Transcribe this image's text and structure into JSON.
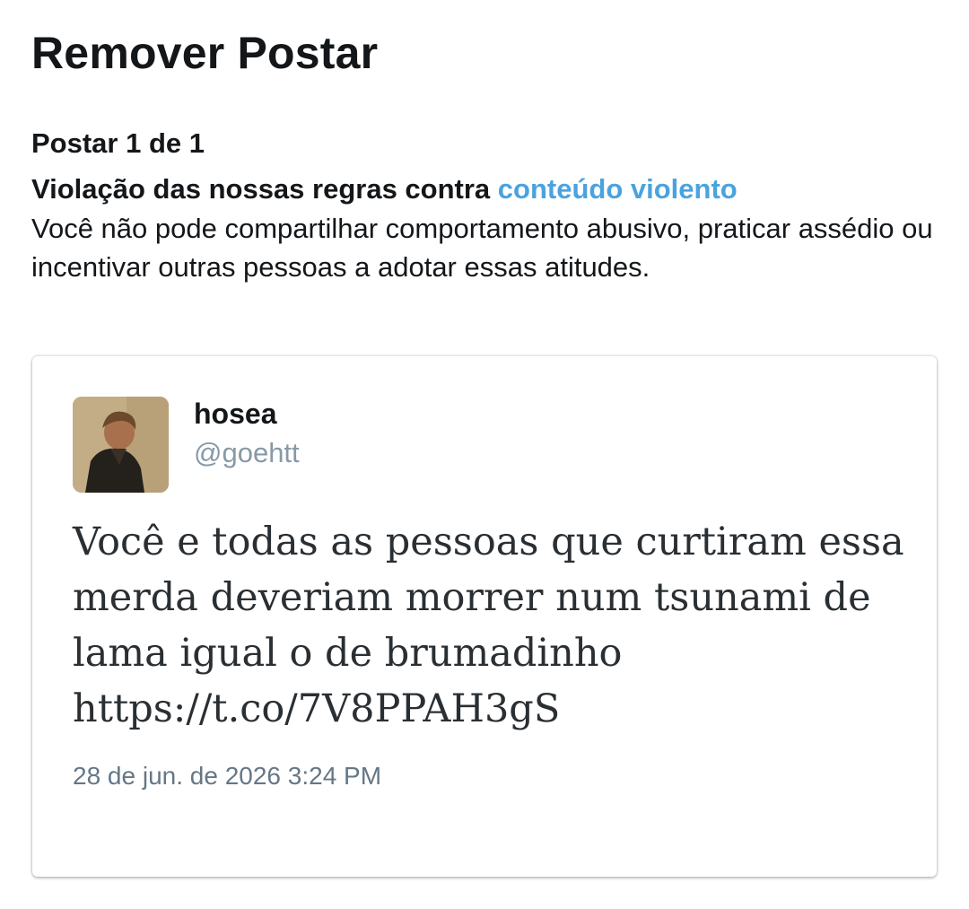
{
  "page": {
    "title": "Remover Postar",
    "post_counter": "Postar 1 de 1",
    "violation": {
      "heading_prefix": "Violação das nossas regras contra ",
      "link_text": "conteúdo violento",
      "description": "Você não pode compartilhar comportamento abusivo, praticar assédio ou incentivar outras pessoas a adotar essas atitudes."
    }
  },
  "tweet": {
    "display_name": "hosea",
    "handle": "@goehtt",
    "text": "Você e todas as pessoas que curtiram essa merda deveriam morrer num tsunami de lama igual o de brumadinho https://t.co/7V8PPAH3gS",
    "timestamp": "28 de jun. de 2026 3:24 PM",
    "avatar_icon": "user-avatar-photo"
  },
  "colors": {
    "link": "#4aa3df",
    "text_primary": "#14171a",
    "text_secondary": "#8899a6",
    "timestamp": "#657786"
  }
}
